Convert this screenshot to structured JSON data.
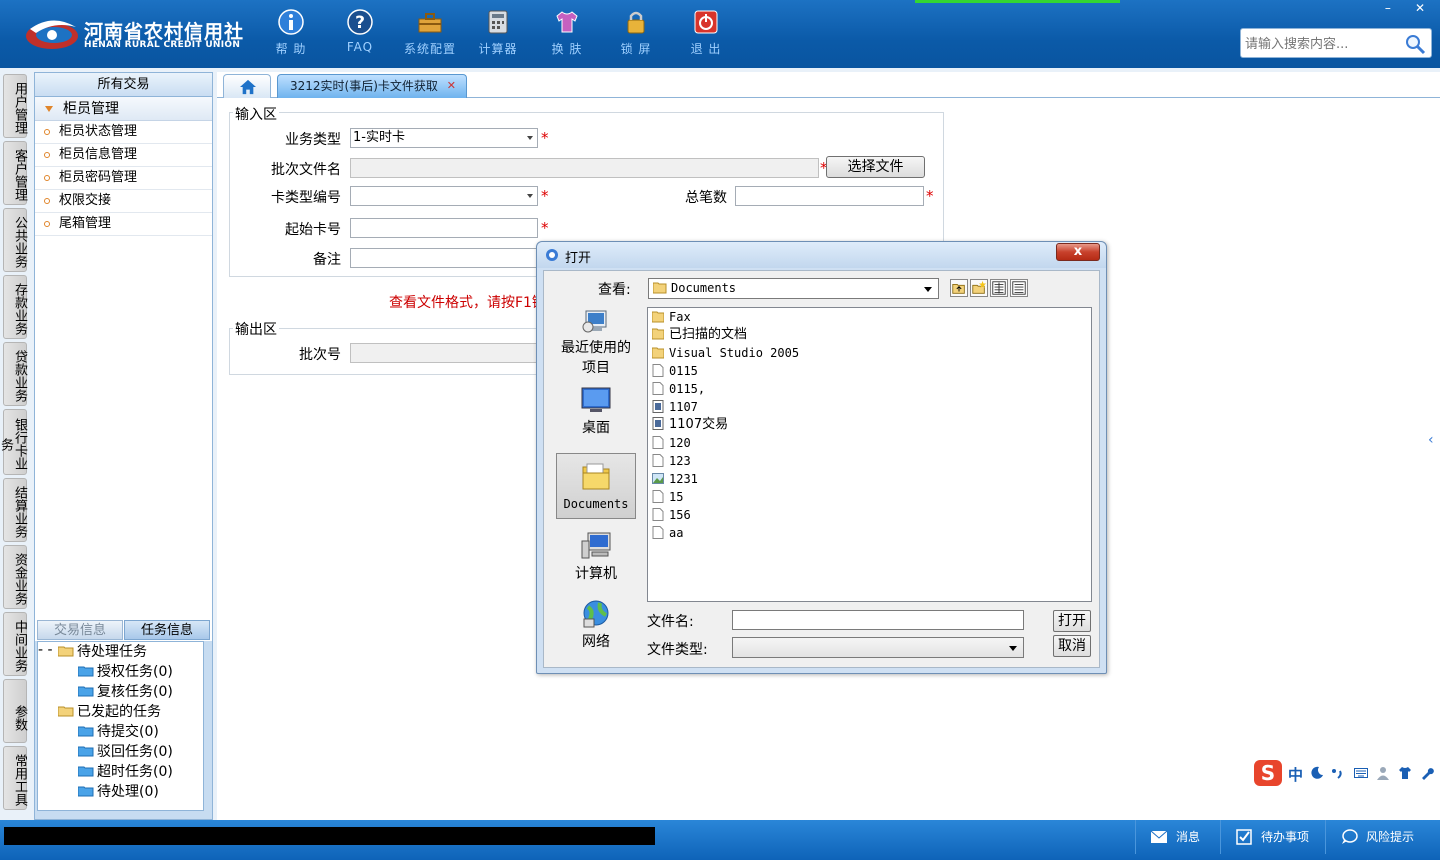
{
  "app": {
    "logo_cn": "河南省农村信用社",
    "logo_en": "HENAN RURAL CREDIT UNION",
    "accent": "#0b5aa8"
  },
  "toolbar": [
    {
      "label": "帮 助",
      "icon": "info-icon"
    },
    {
      "label": "FAQ",
      "icon": "question-icon"
    },
    {
      "label": "系统配置",
      "icon": "toolbox-icon"
    },
    {
      "label": "计算器",
      "icon": "calculator-icon"
    },
    {
      "label": "换 肤",
      "icon": "shirt-icon"
    },
    {
      "label": "锁 屏",
      "icon": "lock-icon"
    },
    {
      "label": "退 出",
      "icon": "power-icon"
    }
  ],
  "window_controls": {
    "minimize": "–",
    "close": "✕"
  },
  "search": {
    "placeholder": "请输入搜索内容..."
  },
  "vertical_tabs": [
    "用户管理",
    "客户管理",
    "公共业务",
    "存款业务",
    "贷款业务",
    "银行卡业务",
    "结算业务",
    "资金业务",
    "中间业务",
    "参数",
    "常用工具"
  ],
  "left_panel": {
    "header": "所有交易",
    "group": "柜员管理",
    "items": [
      "柜员状态管理",
      "柜员信息管理",
      "柜员密码管理",
      "权限交接",
      "尾箱管理"
    ],
    "tabs": [
      "交易信息",
      "任务信息"
    ],
    "tree": {
      "pending": "待处理任务",
      "pending_children": [
        "授权任务(0)",
        "复核任务(0)"
      ],
      "initiated": "已发起的任务",
      "initiated_children": [
        "待提交(0)",
        "驳回任务(0)",
        "超时任务(0)",
        "待处理(0)"
      ]
    }
  },
  "tabs": {
    "home_icon": "home-icon",
    "active": "3212实时(事后)卡文件获取",
    "close": "✕"
  },
  "form": {
    "input_legend": "输入区",
    "business_type_label": "业务类型",
    "business_type_value": "1-实时卡",
    "batch_file_label": "批次文件名",
    "batch_file_value": "",
    "choose_file_button": "选择文件",
    "card_type_label": "卡类型编号",
    "card_type_value": "",
    "total_count_label": "总笔数",
    "total_count_value": "",
    "start_card_label": "起始卡号",
    "start_card_value": "",
    "remark_label": "备注",
    "remark_value": "",
    "required_mark": "*",
    "hint": "查看文件格式，请按F1键",
    "output_legend": "输出区",
    "batch_no_label": "批次号",
    "batch_no_value": ""
  },
  "dialog": {
    "title": "打开",
    "close": "x",
    "look_in_label": "查看:",
    "look_in_value": "Documents",
    "places": [
      {
        "label": "最近使用的项目",
        "icon": "recent-items-icon"
      },
      {
        "label": "桌面",
        "icon": "desktop-icon"
      },
      {
        "label": "Documents",
        "icon": "documents-folder-icon"
      },
      {
        "label": "计算机",
        "icon": "computer-icon"
      },
      {
        "label": "网络",
        "icon": "network-icon"
      }
    ],
    "files": [
      {
        "name": "Fax",
        "type": "folder"
      },
      {
        "name": "已扫描的文档",
        "type": "folder"
      },
      {
        "name": "Visual Studio 2005",
        "type": "folder"
      },
      {
        "name": "0115",
        "type": "file"
      },
      {
        "name": "0115,",
        "type": "file"
      },
      {
        "name": "1107",
        "type": "sheet"
      },
      {
        "name": "1107交易",
        "type": "sheet"
      },
      {
        "name": "120",
        "type": "file"
      },
      {
        "name": "123",
        "type": "file"
      },
      {
        "name": "1231",
        "type": "image"
      },
      {
        "name": "15",
        "type": "file"
      },
      {
        "name": "156",
        "type": "file"
      },
      {
        "name": "aa",
        "type": "file"
      }
    ],
    "filename_label": "文件名:",
    "filename_value": "",
    "filetype_label": "文件类型:",
    "filetype_value": "",
    "open_button": "打开",
    "cancel_button": "取消"
  },
  "ime": {
    "logo": "S",
    "mode": "中"
  },
  "statusbar": {
    "messages": "消息",
    "todo": "待办事项",
    "risk": "风险提示"
  }
}
